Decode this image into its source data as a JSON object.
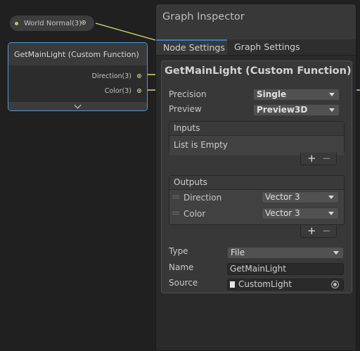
{
  "graph": {
    "world_normal_label": "World Normal(3)",
    "node_title": "GetMainLight (Custom Function)",
    "outputs": [
      "Direction(3)",
      "Color(3)"
    ]
  },
  "inspector": {
    "title": "Graph Inspector",
    "tabs": [
      "Node Settings",
      "Graph Settings"
    ],
    "card_title": "GetMainLight (Custom Function) Node",
    "precision_label": "Precision",
    "precision_value": "Single",
    "preview_label": "Preview",
    "preview_value": "Preview3D",
    "inputs_header": "Inputs",
    "inputs_empty": "List is Empty",
    "outputs_header": "Outputs",
    "outputs": [
      {
        "name": "Direction",
        "type": "Vector 3"
      },
      {
        "name": "Color",
        "type": "Vector 3"
      }
    ],
    "type_label": "Type",
    "type_value": "File",
    "name_label": "Name",
    "name_value": "GetMainLight",
    "source_label": "Source",
    "source_value": "CustomLight",
    "plus": "+",
    "minus": "−"
  },
  "colors": {
    "wire": "#d6e06a",
    "selection": "#4a9ad8",
    "tab_active": "#3a79bb"
  }
}
